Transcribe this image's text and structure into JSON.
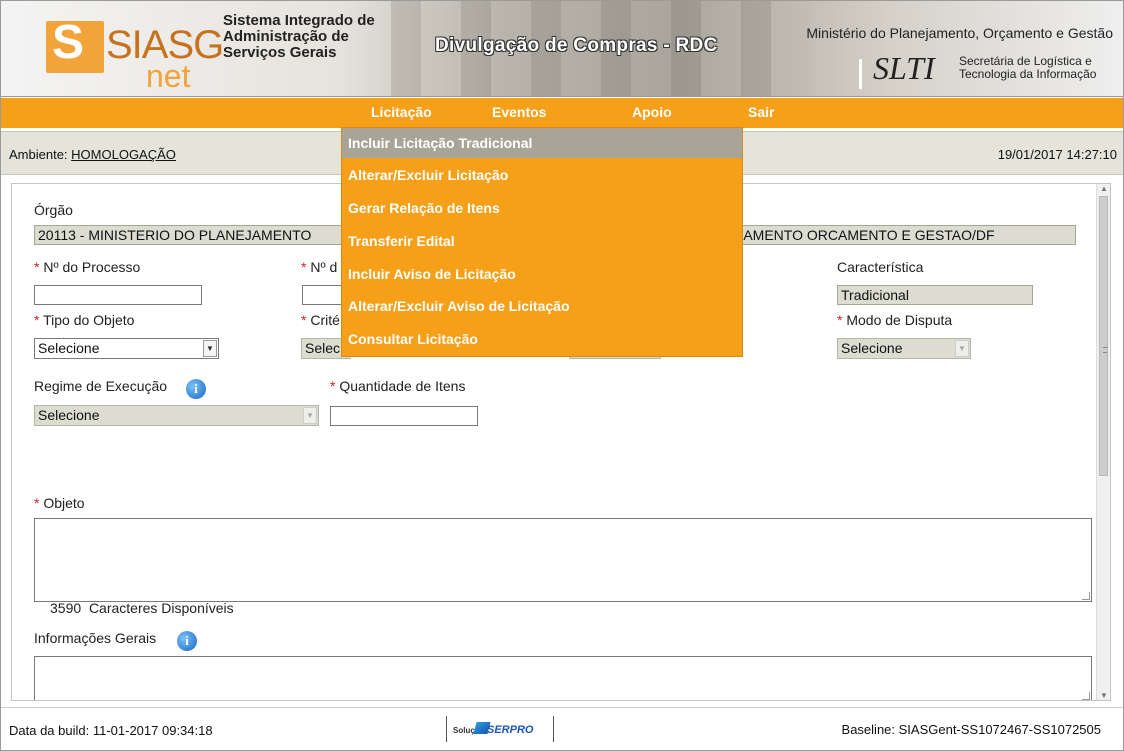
{
  "header": {
    "logo_main": "SIASG",
    "logo_sub": "net",
    "system_name_lines": [
      "Sistema Integrado de",
      "Administração de",
      "Serviços Gerais"
    ],
    "app_title": "Divulgação de Compras - RDC",
    "ministry": "Ministério do Planejamento, Orçamento e Gestão",
    "slti_logo": "SLTI",
    "slti_lines": [
      "Secretária de Logística e",
      "Tecnologia da Informação"
    ]
  },
  "menu": {
    "items": [
      "Licitação",
      "Eventos",
      "Apoio",
      "Sair"
    ],
    "active": "Licitação",
    "dropdown": [
      "Incluir Licitação Tradicional",
      "Alterar/Excluir Licitação",
      "Gerar Relação de Itens",
      "Transferir Edital",
      "Incluir Aviso de Licitação",
      "Alterar/Excluir Aviso de Licitação",
      "Consultar Licitação"
    ]
  },
  "environment": {
    "label": "Ambiente: ",
    "value": "HOMOLOGAÇÃO",
    "datetime": "19/01/2017 14:27:10"
  },
  "form": {
    "orgao_label": "Órgão",
    "orgao_left": "20113 - MINISTERIO DO PLANEJAMENTO",
    "orgao_right": "EJAMENTO ORCAMENTO E GESTAO/DF",
    "required_mark": "*",
    "processo_label": " Nº do Processo",
    "numero_label": " Nº d",
    "caracteristica_label": "Característica",
    "caracteristica_value": "Tradicional",
    "tipo_objeto_label": " Tipo do Objeto",
    "tipo_objeto_value": "Selecione",
    "criterio_label": " Crité",
    "criterio_value": "Selec",
    "modo_disputa_label": " Modo de Disputa",
    "modo_disputa_value": "Selecione",
    "regime_label": "Regime de Execução",
    "regime_value": "Selecione",
    "quantidade_label": " Quantidade de Itens",
    "objeto_label": " Objeto",
    "caracteres_count": "3590",
    "caracteres_label": "Caracteres Disponíveis",
    "info_gerais_label": "Informações Gerais",
    "info_icon": "i"
  },
  "footer": {
    "build": "Data da build: 11-01-2017 09:34:18",
    "solucao": "Solução",
    "serpro": "SERPRO",
    "baseline": "Baseline: SIASGent-SS1072467-SS1072505"
  },
  "colors": {
    "menu_orange": "#f6a01a",
    "dropdown_hover": "#a9a498",
    "required_red": "#cc2222",
    "readonly_bg": "#dcdcd0"
  }
}
